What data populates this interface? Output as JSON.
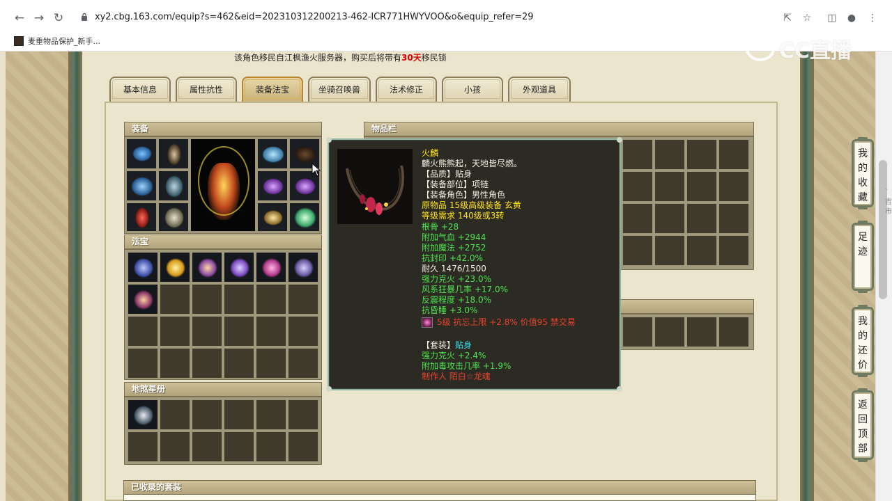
{
  "browser": {
    "url": "xy2.cbg.163.com/equip?s=462&eid=202310312200213-462-ICR771HWYVOO&o&equip_refer=29",
    "bookmark": "麦重物品保护_新手..."
  },
  "watermark": "CC直播",
  "notice": {
    "prefix": "该角色移民自江枫渔火服务器，购买后将带有",
    "highlight": "30天",
    "suffix": "移民锁"
  },
  "tabs": [
    {
      "label": "基本信息",
      "active": false
    },
    {
      "label": "属性抗性",
      "active": false
    },
    {
      "label": "装备法宝",
      "active": true
    },
    {
      "label": "坐骑召唤兽",
      "active": false
    },
    {
      "label": "法术修正",
      "active": false
    },
    {
      "label": "小孩",
      "active": false
    },
    {
      "label": "外观道具",
      "active": false
    }
  ],
  "sections": {
    "equipment": "装备",
    "inventory": "物品栏",
    "treasure": "法宝",
    "star_book": "地煞星册",
    "collected_sets": "已收录的套装"
  },
  "tooltip": {
    "name": "火麟",
    "desc": "麟火熊熊起，天地皆尽燃。",
    "quality": "【品质】贴身",
    "slot": "【装备部位】项链",
    "role": "【装备角色】男性角色",
    "origin": "原物品 15级高级装备 玄黄",
    "req": "等级需求 140级或3转",
    "stat_lines": [
      {
        "text": "根骨 +28",
        "color": "green"
      },
      {
        "text": "附加气血 +2944",
        "color": "green"
      },
      {
        "text": "附加魔法 +2752",
        "color": "green"
      },
      {
        "text": "抗封印 +42.0%",
        "color": "green"
      },
      {
        "text": "耐久 1476/1500",
        "color": "white"
      },
      {
        "text": "强力克火 +23.0%",
        "color": "green"
      },
      {
        "text": "风系狂暴几率 +17.0%",
        "color": "green"
      },
      {
        "text": "反震程度 +18.0%",
        "color": "green"
      },
      {
        "text": "抗昏睡 +3.0%",
        "color": "green"
      }
    ],
    "gem_line": "5级 抗忘上限 +2.8% 价值95 禁交易",
    "set_label": "【套装】",
    "set_name": "贴身",
    "set_lines": [
      "强力克火 +2.4%",
      "附加毒攻击几率 +1.9%"
    ],
    "maker": "制作人 陌白☆龙魂"
  },
  "side_buttons": [
    "我的收藏",
    "足迹",
    "我的还价",
    "返回顶部"
  ],
  "edge_text": [
    "`",
    "吉",
    "市"
  ],
  "colors": {
    "accent_red": "#d40000",
    "tooltip_bg": "#2b2b24",
    "tooltip_border": "#8fb39d",
    "name_yellow": "#ffe21c",
    "stat_green": "#4fe34f",
    "maker_red": "#e8422e"
  }
}
